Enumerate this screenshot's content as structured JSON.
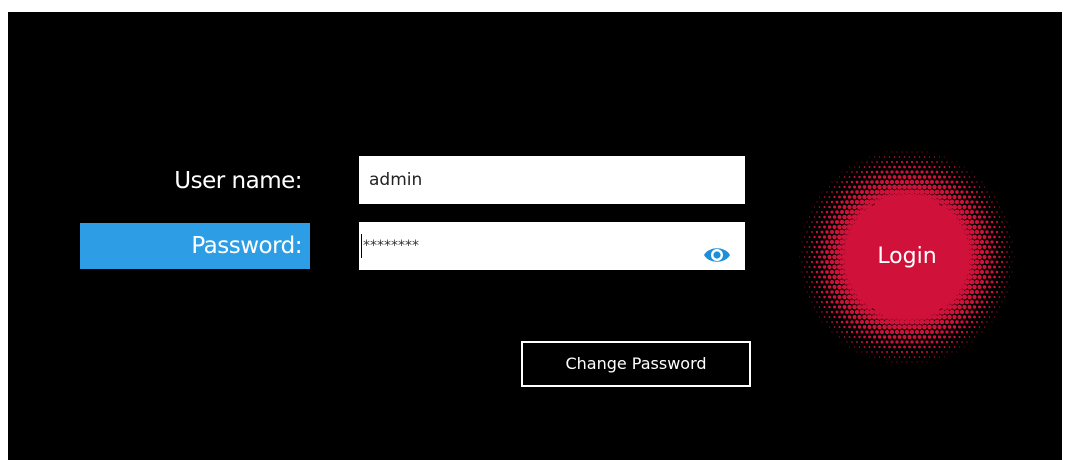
{
  "form": {
    "username_label": "User name:",
    "password_label": "Password:",
    "username_value": "admin",
    "password_value": "********",
    "change_password_label": "Change Password",
    "login_label": "Login"
  },
  "colors": {
    "background": "#000000",
    "selected_label": "#2d9ee6",
    "login_red": "#d0123b",
    "eye_icon": "#1e8ed8"
  },
  "icons": {
    "show_password": "eye-icon"
  }
}
